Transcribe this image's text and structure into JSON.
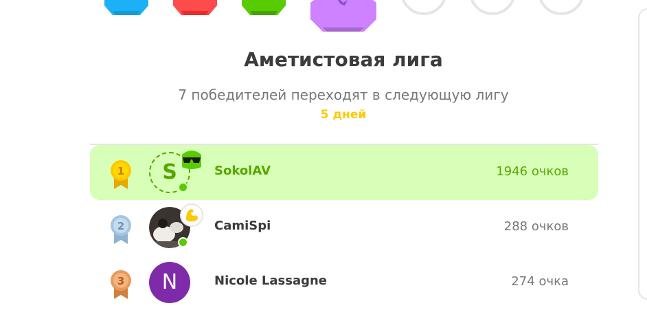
{
  "league": {
    "title": "Аметистовая лига",
    "subtitle": "7 победителей переходят в следующую лигу",
    "time_left": "5 дней",
    "badge_colors": [
      "#1cb0f6",
      "#ff4b4b",
      "#58cc02",
      "#ce82ff",
      "#e5e5e5",
      "#e5e5e5",
      "#e5e5e5"
    ]
  },
  "leaderboard": [
    {
      "rank": "1",
      "medal_color": "#ffc800",
      "avatar_letter": "S",
      "avatar_style": "dashed-letter",
      "avatar_badge_icon": "duo-sunglasses-icon",
      "online": true,
      "name": "SokolAV",
      "points": "1946 очков",
      "current_user": true
    },
    {
      "rank": "2",
      "medal_color": "#a5c5e0",
      "avatar_style": "photo",
      "avatar_badge_icon": "flexed-biceps-icon",
      "online": true,
      "name": "CamiSpi",
      "points": "288 очков",
      "current_user": false
    },
    {
      "rank": "3",
      "medal_color": "#e89a5b",
      "avatar_letter": "N",
      "avatar_style": "solid-letter",
      "avatar_color": "#7f2aa8",
      "online": false,
      "name": "Nicole Lassagne",
      "points": "274 очка",
      "current_user": false
    }
  ]
}
